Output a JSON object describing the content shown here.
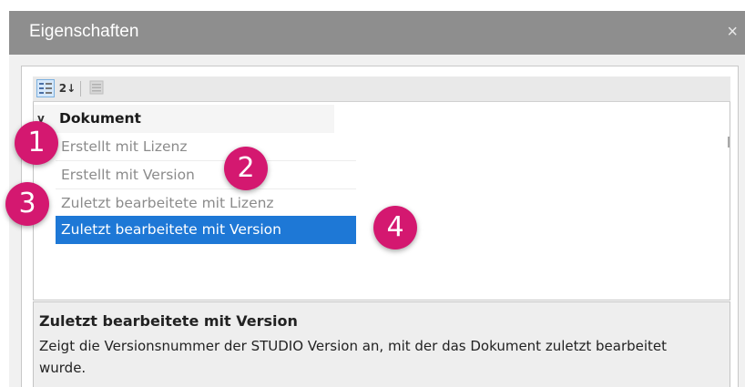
{
  "window": {
    "title": "Eigenschaften",
    "close_glyph": "×"
  },
  "toolbar": {
    "categorized_icon": "categorized-view-icon",
    "alphabetical_icon": "sort-alphabetical-icon",
    "alphabetical_glyph": "2↓",
    "property_pages_icon": "property-pages-icon"
  },
  "grid": {
    "category": {
      "label": "Dokument",
      "chevron": "v"
    },
    "rows": [
      {
        "label": "Erstellt mit Lizenz"
      },
      {
        "label": "Erstellt mit Version"
      },
      {
        "label": "Zuletzt bearbeitete mit Lizenz"
      },
      {
        "label": "Zuletzt bearbeitete mit Version"
      }
    ],
    "selected_index": 3
  },
  "description": {
    "title": "Zuletzt bearbeitete mit Version",
    "text": "Zeigt die Versionsnummer der STUDIO Version an, mit der das Dokument zuletzt bearbeitet wurde."
  },
  "callouts": [
    "1",
    "2",
    "3",
    "4"
  ],
  "colors": {
    "titlebar": "#8e8e8e",
    "selection": "#1e78d6",
    "callout": "#d41870"
  }
}
